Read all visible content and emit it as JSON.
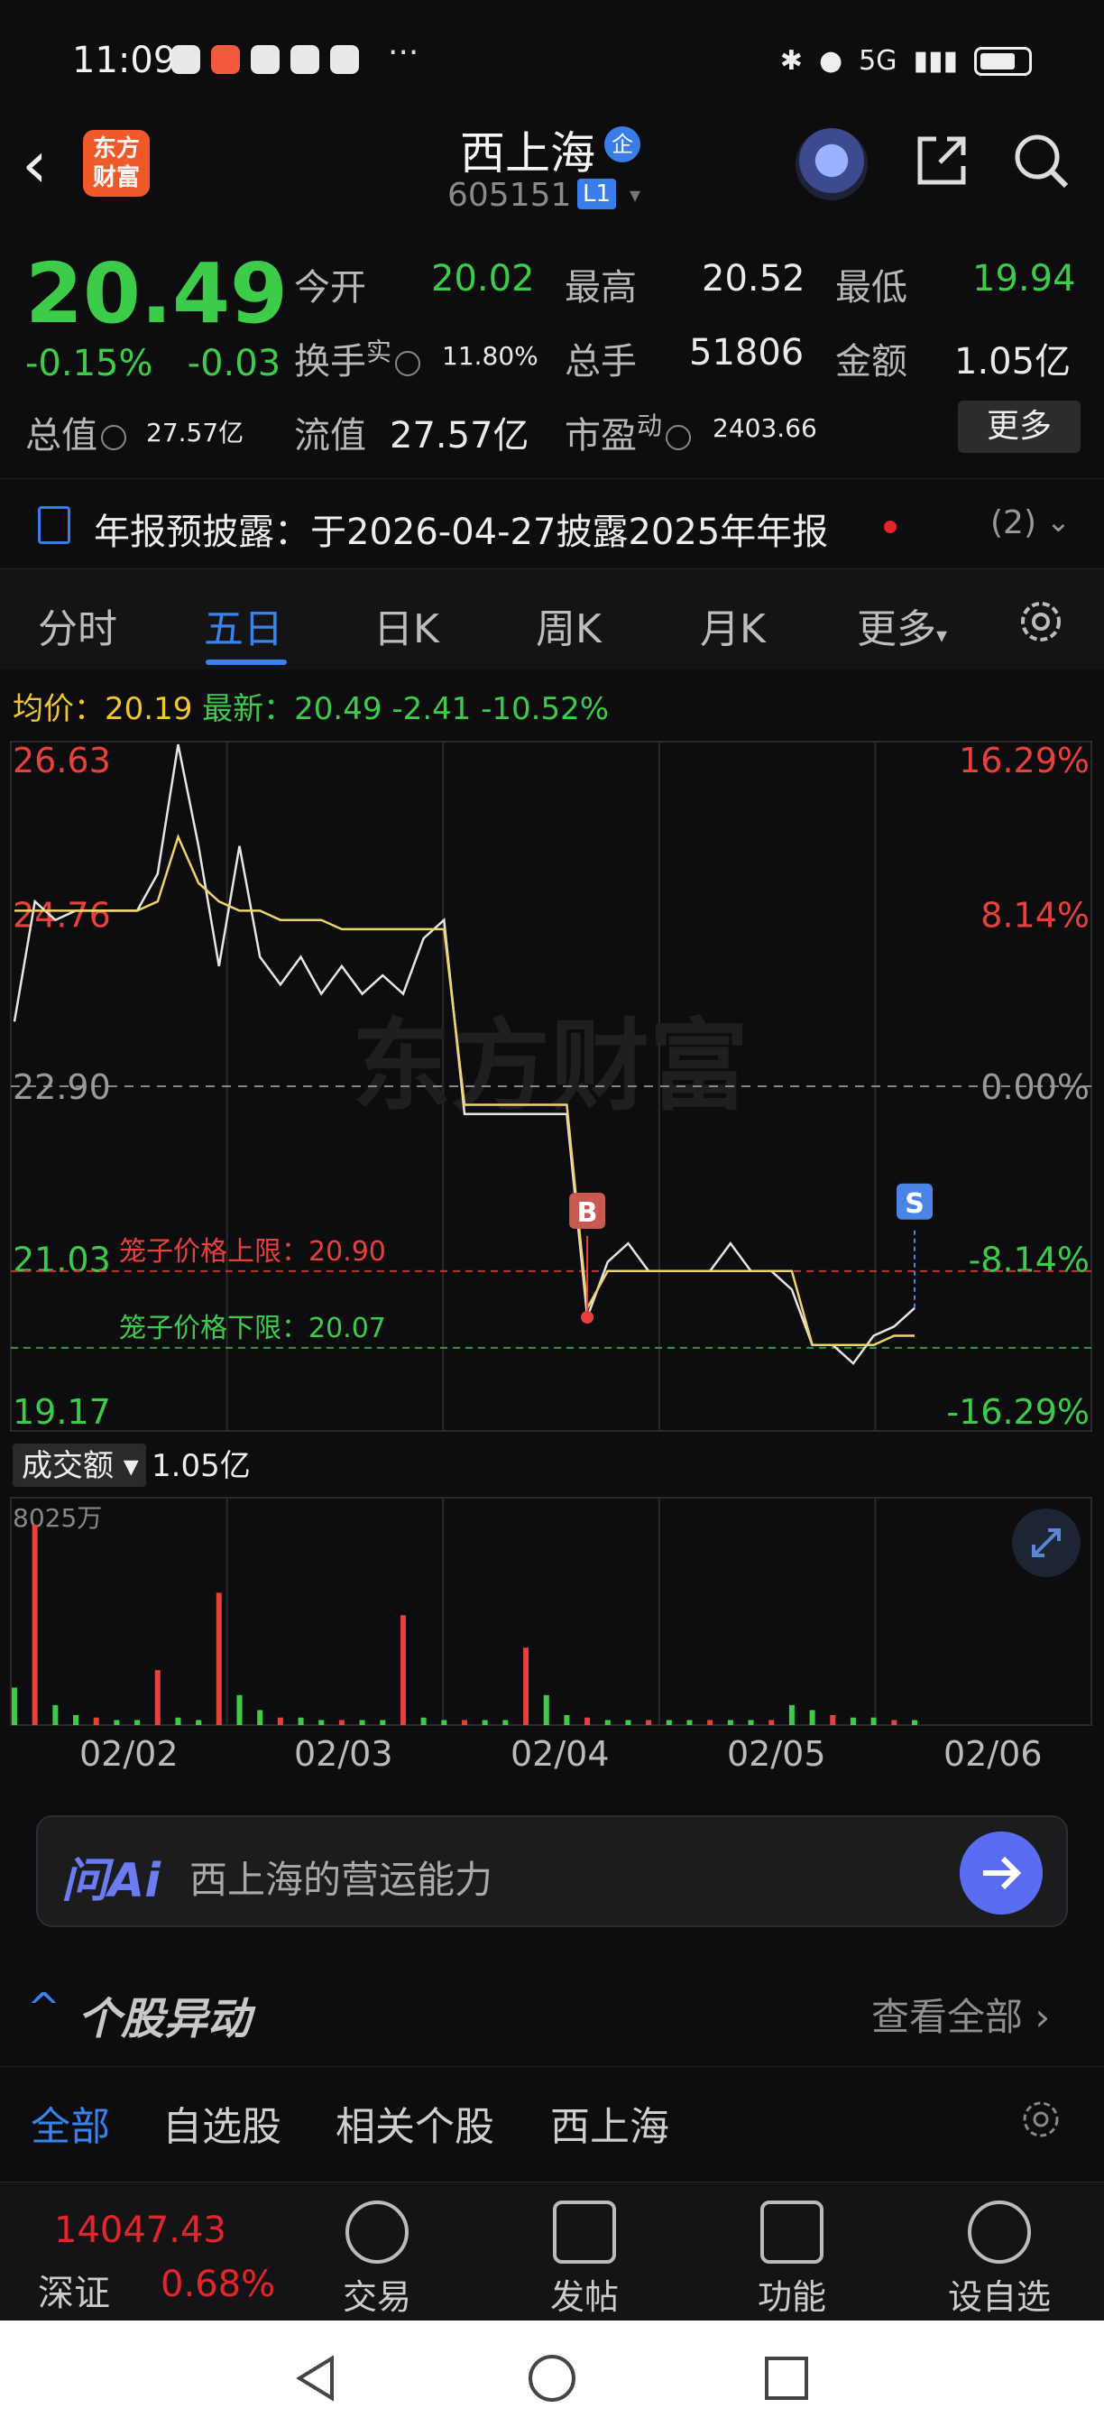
{
  "status": {
    "time": "11:09",
    "more": "···",
    "network": "5G"
  },
  "header": {
    "logo_line1": "东方",
    "logo_line2": "财富",
    "name": "西上海",
    "badge": "企",
    "code": "605151",
    "level": "L1"
  },
  "quote": {
    "price": "20.49",
    "change_pct": "-0.15%",
    "change": "-0.03",
    "open_label": "今开",
    "open": "20.02",
    "high_label": "最高",
    "high": "20.52",
    "low_label": "最低",
    "low": "19.94",
    "turnover_label": "换手",
    "turnover_sup": "实",
    "turnover": "11.80%",
    "volume_label": "总手",
    "volume": "51806",
    "amount_label": "金额",
    "amount": "1.05亿",
    "mktcap_label": "总值",
    "mktcap": "27.57亿",
    "float_label": "流值",
    "float": "27.57亿",
    "pe_label": "市盈",
    "pe_sup": "动",
    "pe": "2403.66",
    "more": "更多"
  },
  "notice": {
    "text": "年报预披露：于2026-04-27披露2025年年报",
    "count": "(2)"
  },
  "tabs": [
    "分时",
    "五日",
    "日K",
    "周K",
    "月K",
    "更多"
  ],
  "avg_line": {
    "avg_label": "均价：",
    "avg": "20.19",
    "latest_label": "最新：",
    "latest": "20.49",
    "diff": "-2.41",
    "diff_pct": "-10.52%"
  },
  "chart_data": {
    "type": "line",
    "title": "",
    "x": [
      "02/02",
      "02/03",
      "02/04",
      "02/05",
      "02/06"
    ],
    "ylim": [
      19.17,
      26.63
    ],
    "y_ticks": [
      "26.63",
      "24.76",
      "22.90",
      "21.03",
      "19.17"
    ],
    "pct_ticks": [
      "16.29%",
      "8.14%",
      "0.00%",
      "-8.14%",
      "-16.29%"
    ],
    "cage_upper_label": "笼子价格上限：20.90",
    "cage_upper": 20.9,
    "cage_lower_label": "笼子价格下限：20.07",
    "cage_lower": 20.07,
    "buy_marker": "B",
    "sell_marker": "S",
    "watermark": "东方财富",
    "series": [
      {
        "values": [
          23.6,
          24.9,
          24.7,
          24.8,
          24.8,
          24.8,
          24.8,
          25.2,
          26.6,
          25.5,
          24.2,
          25.5,
          24.3,
          24.0,
          24.3,
          23.9,
          24.2,
          23.9,
          24.1,
          23.9,
          24.5,
          24.7,
          22.6,
          22.6,
          22.6,
          22.6,
          22.6,
          22.6,
          20.4,
          21.0,
          21.2,
          20.9,
          20.9,
          20.9,
          20.9,
          21.2,
          20.9,
          20.9,
          20.7,
          20.1,
          20.1,
          19.9,
          20.2,
          20.3,
          20.5
        ]
      },
      {
        "values": [
          24.8,
          24.8,
          24.8,
          24.8,
          24.8,
          24.8,
          24.8,
          24.9,
          25.6,
          25.1,
          24.9,
          24.8,
          24.8,
          24.7,
          24.7,
          24.7,
          24.6,
          24.6,
          24.6,
          24.6,
          24.6,
          24.6,
          22.7,
          22.7,
          22.7,
          22.7,
          22.7,
          22.7,
          20.5,
          20.9,
          20.9,
          20.9,
          20.9,
          20.9,
          20.9,
          20.9,
          20.9,
          20.9,
          20.9,
          20.1,
          20.1,
          20.1,
          20.1,
          20.2,
          20.2
        ]
      }
    ],
    "volume": {
      "label": "成交额",
      "total": "1.05亿",
      "max_label": "8025万",
      "max": 8025,
      "values": [
        1500,
        8025,
        800,
        400,
        300,
        200,
        200,
        2200,
        300,
        200,
        5300,
        1200,
        600,
        300,
        300,
        200,
        200,
        200,
        200,
        4400,
        300,
        200,
        200,
        200,
        200,
        3100,
        1200,
        400,
        300,
        200,
        200,
        200,
        200,
        200,
        200,
        200,
        200,
        200,
        800,
        600,
        400,
        300,
        300,
        200,
        200
      ]
    }
  },
  "ai": {
    "logo": "问Ai",
    "prompt": "西上海的营运能力"
  },
  "movers": {
    "title": "个股异动",
    "view_all": "查看全部"
  },
  "subtabs": [
    "全部",
    "自选股",
    "相关个股",
    "西上海"
  ],
  "bottom": {
    "index_value": "14047.43",
    "index_name": "深证",
    "index_pct": "0.68%",
    "nav": [
      "交易",
      "发帖",
      "功能",
      "设自选"
    ]
  }
}
